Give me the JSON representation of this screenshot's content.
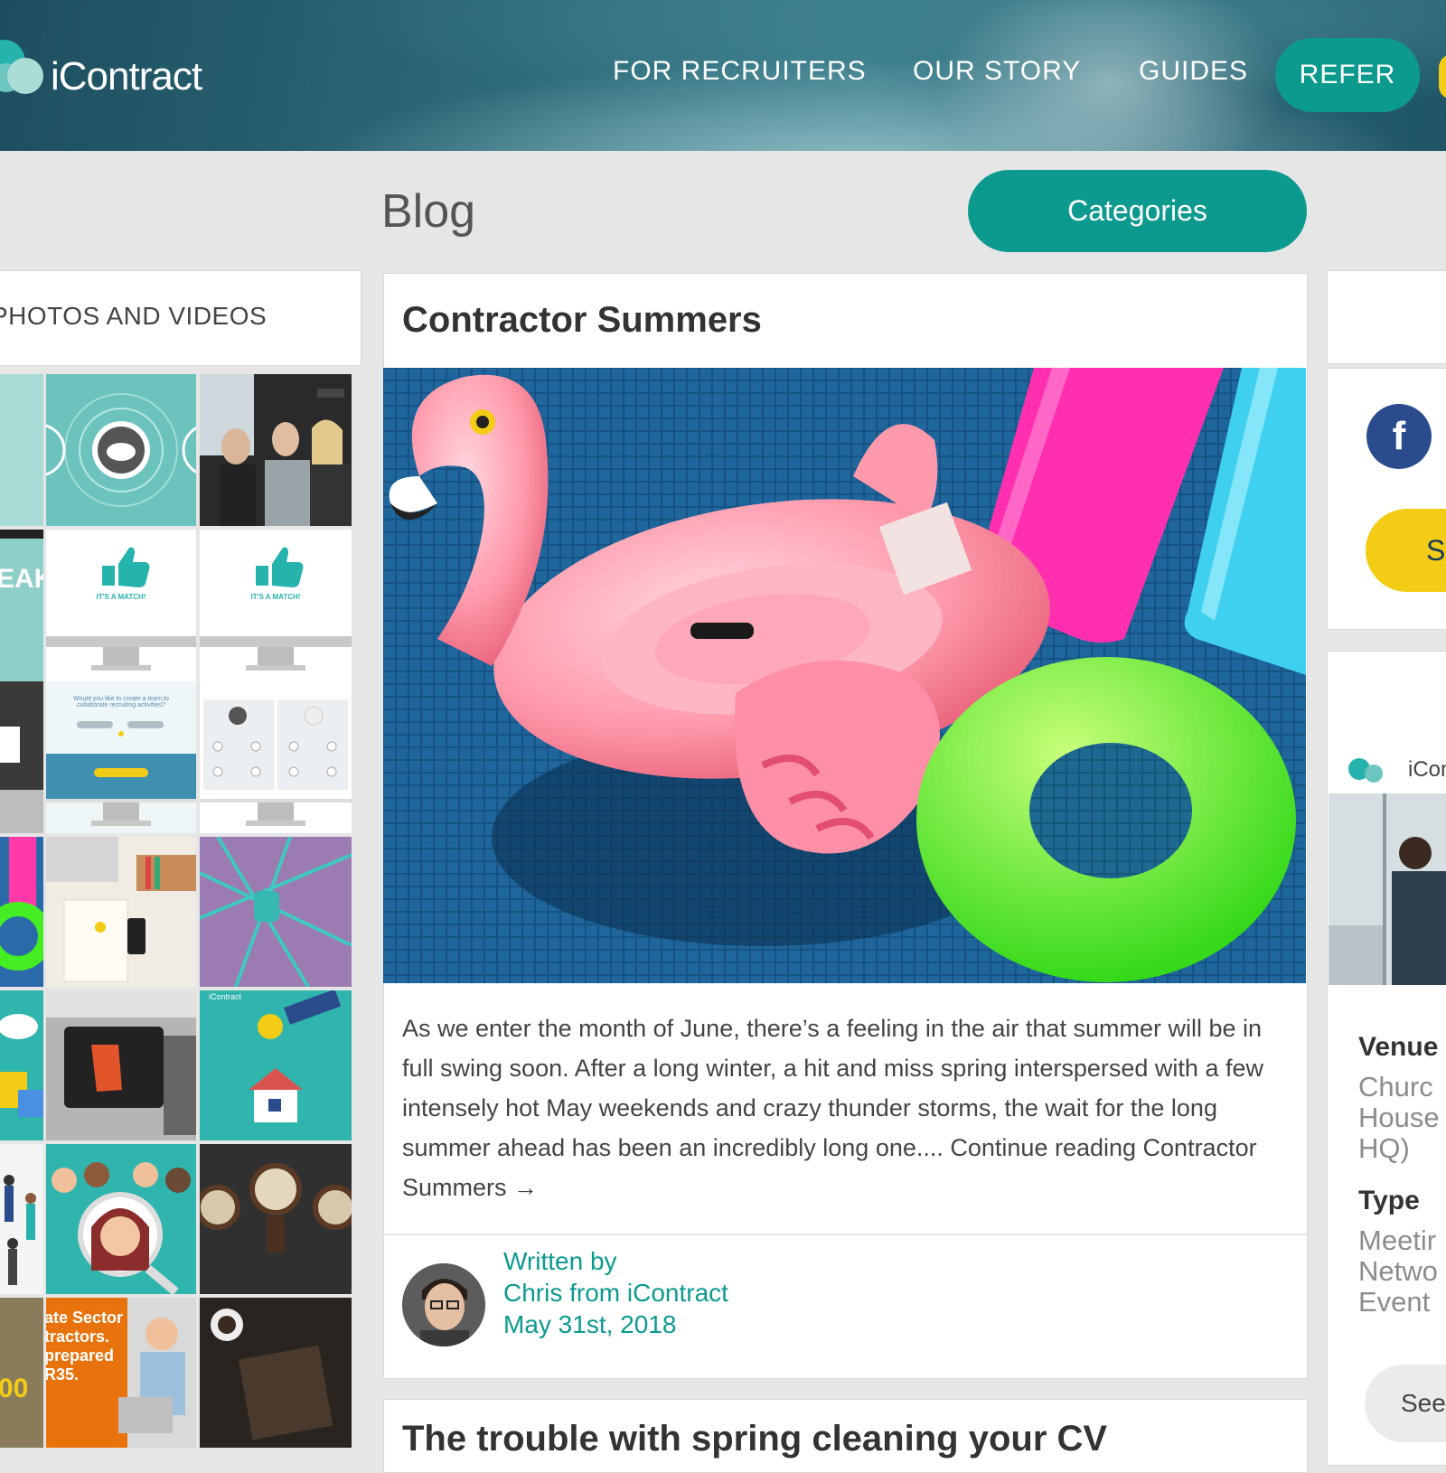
{
  "header": {
    "logo_text": "iContract",
    "nav": [
      "FOR RECRUITERS",
      "OUR STORY",
      "GUIDES"
    ],
    "refer_label": "REFER"
  },
  "blog": {
    "title": "Blog",
    "categories_label": "Categories"
  },
  "left_widget": {
    "title": "PHOTOS AND VIDEOS",
    "tile_texts": {
      "match1": "IT'S A MATCH!",
      "match2": "IT'S A MATCH!",
      "team_question": "Would you like to create a team to collaborate recruiting activities?",
      "speak": "EAK",
      "ir35": "ate Sector tractors. prepared R35.",
      "mini_logo": "iContract"
    }
  },
  "post": {
    "title": "Contractor Summers",
    "excerpt": "As we enter the month of June, there’s a feeling in the air that summer will be in full swing soon. After a long winter, a hit and miss spring interspersed with a few intensely hot May weekends and crazy thunder storms, the wait for the long summer ahead has been an incredibly long one.... Continue reading Contractor Summers →",
    "written_by": "Written by",
    "author": "Chris from iContract",
    "date": "May 31st, 2018"
  },
  "next_post": {
    "title": "The trouble with spring cleaning your CV"
  },
  "sidebar": {
    "facebook_icon": "facebook-icon",
    "yellow_button_label": "Si",
    "event_logo": "iCon",
    "venue_label": "Venue",
    "venue_value": [
      "Churc",
      "House",
      "HQ)"
    ],
    "type_label": "Type",
    "type_value": [
      "Meetir",
      "Netwo",
      "Event"
    ],
    "see_label": "See"
  },
  "colors": {
    "accent": "#0c9a8f",
    "yellow": "#f3cc16",
    "facebook": "#2b4c8c"
  }
}
